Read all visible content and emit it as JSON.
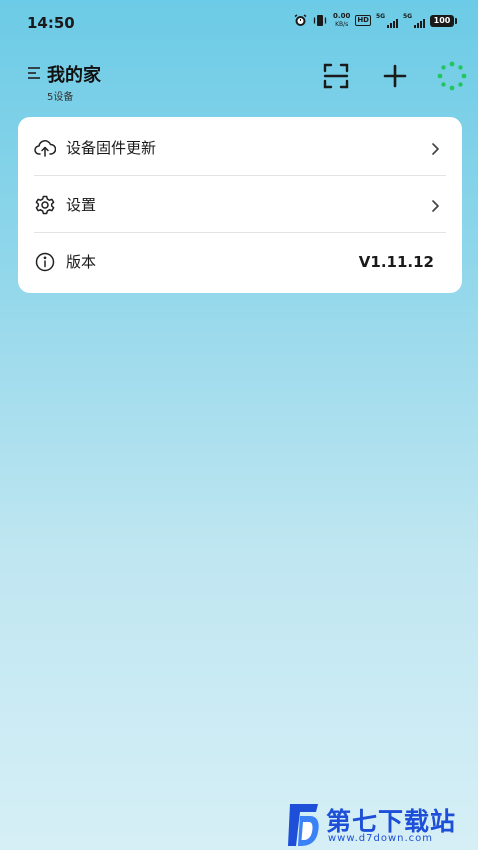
{
  "status_bar": {
    "time": "14:50",
    "net_speed_value": "0.00",
    "net_speed_unit": "KB/s",
    "hd_label": "HD",
    "sim1_label": "5G",
    "sim2_label": "5G",
    "battery": "100",
    "icons": [
      "alarm-icon",
      "vibrate-icon",
      "hd-icon",
      "signal-icon",
      "signal-icon",
      "battery-icon"
    ]
  },
  "header": {
    "title": "我的家",
    "device_count": "5设备",
    "icons": [
      "menu-icon",
      "scan-icon",
      "plus-icon",
      "loading-dots-icon"
    ]
  },
  "menu": {
    "firmware_update": "设备固件更新",
    "settings": "设置",
    "version_label": "版本",
    "version_value": "V1.11.12",
    "icons": [
      "cloud-upload-icon",
      "gear-icon",
      "info-icon",
      "chevron-right-icon"
    ]
  },
  "watermark": {
    "title": "第七下载站",
    "url": "www.d7down.com"
  },
  "colors": {
    "bg_top": "#6ccbe6",
    "bg_bottom": "#d6eff6",
    "accent_green": "#22c55e",
    "watermark_blue": "#1d4fd8"
  }
}
